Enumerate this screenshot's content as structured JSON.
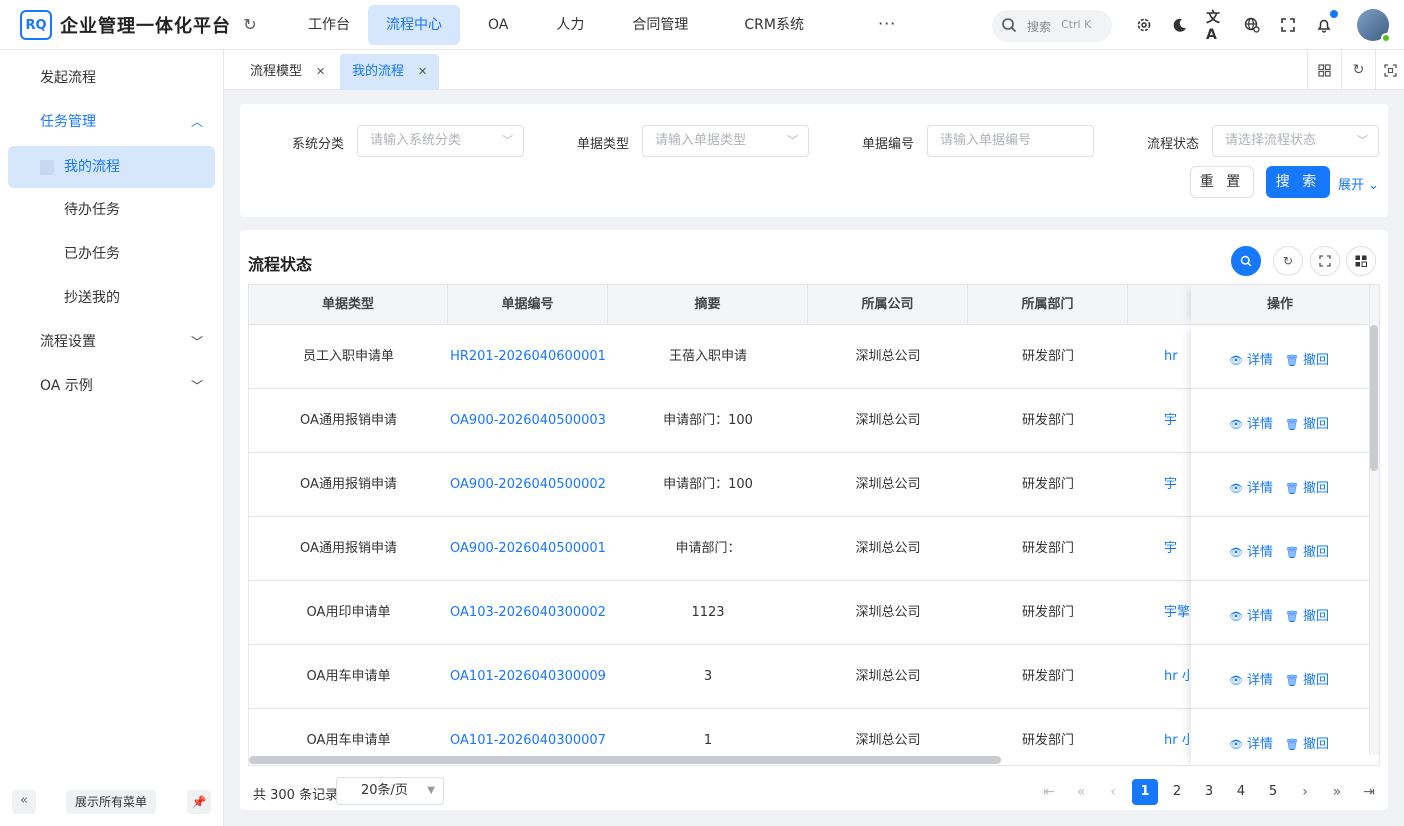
{
  "app": {
    "logo": "RQ",
    "title": "企业管理一体化平台"
  },
  "nav": [
    "工作台",
    "流程中心",
    "OA",
    "人力",
    "合同管理",
    "CRM系统"
  ],
  "nav_active": "流程中心",
  "nav_more": "···",
  "search": {
    "placeholder": "搜索",
    "shortcut": "Ctrl K"
  },
  "top_icons": [
    "settings-icon",
    "moon-icon",
    "translate-icon",
    "language-icon",
    "fullscreen-icon",
    "bell-icon"
  ],
  "sidebar": {
    "items": [
      {
        "label": "发起流程"
      },
      {
        "label": "任务管理",
        "expanded": true
      },
      {
        "label": "我的流程",
        "selected": true
      },
      {
        "label": "待办任务"
      },
      {
        "label": "已办任务"
      },
      {
        "label": "抄送我的"
      },
      {
        "label": "流程设置"
      },
      {
        "label": "OA 示例"
      }
    ],
    "show_all": "展示所有菜单",
    "collapse": "«"
  },
  "tabs": [
    {
      "label": "流程模型"
    },
    {
      "label": "我的流程",
      "active": true
    }
  ],
  "filters": {
    "system_category": {
      "label": "系统分类",
      "placeholder": "请输入系统分类"
    },
    "doc_type": {
      "label": "单据类型",
      "placeholder": "请输入单据类型"
    },
    "doc_no": {
      "label": "单据编号",
      "placeholder": "请输入单据编号"
    },
    "status": {
      "label": "流程状态",
      "placeholder": "请选择流程状态"
    },
    "reset": "重 置",
    "search": "搜 索",
    "expand": "展开"
  },
  "table": {
    "title": "流程状态",
    "columns": [
      "单据类型",
      "单据编号",
      "摘要",
      "所属公司",
      "所属部门",
      "",
      "操作"
    ],
    "rows": [
      {
        "type": "员工入职申请单",
        "no": "HR201-2026040600001",
        "summary": "王蓓入职申请",
        "company": "深圳总公司",
        "dept": "研发部门",
        "applicant": "hr"
      },
      {
        "type": "OA通用报销申请",
        "no": "OA900-2026040500003",
        "summary": "申请部门：100",
        "company": "深圳总公司",
        "dept": "研发部门",
        "applicant": "宇"
      },
      {
        "type": "OA通用报销申请",
        "no": "OA900-2026040500002",
        "summary": "申请部门：100",
        "company": "深圳总公司",
        "dept": "研发部门",
        "applicant": "宇"
      },
      {
        "type": "OA通用报销申请",
        "no": "OA900-2026040500001",
        "summary": "申请部门：",
        "company": "深圳总公司",
        "dept": "研发部门",
        "applicant": "宇"
      },
      {
        "type": "OA用印申请单",
        "no": "OA103-2026040300002",
        "summary": "1123",
        "company": "深圳总公司",
        "dept": "研发部门",
        "applicant": "宇擎源"
      },
      {
        "type": "OA用车申请单",
        "no": "OA101-2026040300009",
        "summary": "3",
        "company": "深圳总公司",
        "dept": "研发部门",
        "applicant": "hr 小"
      },
      {
        "type": "OA用车申请单",
        "no": "OA101-2026040300007",
        "summary": "1",
        "company": "深圳总公司",
        "dept": "研发部门",
        "applicant": "hr 小"
      }
    ],
    "op_detail": "详情",
    "op_revoke": "撤回"
  },
  "pager": {
    "total": "共 300 条记录",
    "page_size": "20条/页",
    "pages": [
      "1",
      "2",
      "3",
      "4",
      "5"
    ],
    "current": "1"
  }
}
